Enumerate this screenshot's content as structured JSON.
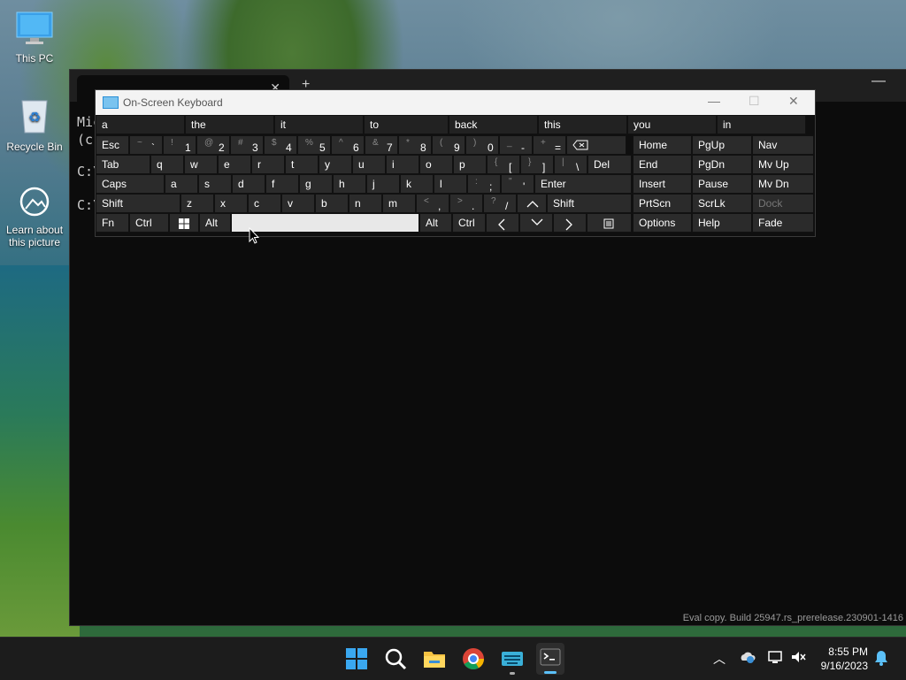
{
  "desktop": {
    "icons": [
      {
        "label": "This PC",
        "icon": "monitor-icon"
      },
      {
        "label": "Recycle Bin",
        "icon": "recycle-bin-icon"
      },
      {
        "label": "Learn about this picture",
        "icon": "learn-icon"
      }
    ]
  },
  "terminal": {
    "lines": [
      "Mic",
      "(c)",
      "C:\\",
      "C:\\"
    ],
    "watermark": "Eval copy. Build 25947.rs_prerelease.230901-1416"
  },
  "osk": {
    "title": "On-Screen Keyboard",
    "predictions": [
      "a",
      "the",
      "it",
      "to",
      "back",
      "this",
      "you",
      "in"
    ],
    "row1": [
      {
        "label": "Esc"
      },
      {
        "sub": "~",
        "main": "`"
      },
      {
        "sub": "!",
        "main": "1"
      },
      {
        "sub": "@",
        "main": "2"
      },
      {
        "sub": "#",
        "main": "3"
      },
      {
        "sub": "$",
        "main": "4"
      },
      {
        "sub": "%",
        "main": "5"
      },
      {
        "sub": "^",
        "main": "6"
      },
      {
        "sub": "&",
        "main": "7"
      },
      {
        "sub": "*",
        "main": "8"
      },
      {
        "sub": "(",
        "main": "9"
      },
      {
        "sub": ")",
        "main": "0"
      },
      {
        "sub": "_",
        "main": "-"
      },
      {
        "sub": "+",
        "main": "="
      }
    ],
    "row2": [
      "Tab",
      "q",
      "w",
      "e",
      "r",
      "t",
      "y",
      "u",
      "i",
      "o",
      "p"
    ],
    "row2_brackets": [
      {
        "sub": "{",
        "main": "["
      },
      {
        "sub": "}",
        "main": "]"
      },
      {
        "sub": "|",
        "main": "\\"
      }
    ],
    "del": "Del",
    "row3": [
      "Caps",
      "a",
      "s",
      "d",
      "f",
      "g",
      "h",
      "j",
      "k",
      "l"
    ],
    "row3_punct": [
      {
        "sub": ":",
        "main": ";"
      },
      {
        "sub": "\"",
        "main": "'"
      }
    ],
    "enter": "Enter",
    "row4": [
      "Shift",
      "z",
      "x",
      "c",
      "v",
      "b",
      "n",
      "m"
    ],
    "row4_punct": [
      {
        "sub": "<",
        "main": ","
      },
      {
        "sub": ">",
        "main": "."
      },
      {
        "sub": "?",
        "main": "/"
      }
    ],
    "shift_right": "Shift",
    "row5": {
      "fn": "Fn",
      "ctrl": "Ctrl",
      "alt": "Alt",
      "alt_right": "Alt",
      "ctrl_right": "Ctrl"
    },
    "nav": [
      [
        "Home",
        "PgUp",
        "Nav"
      ],
      [
        "End",
        "PgDn",
        "Mv Up"
      ],
      [
        "Insert",
        "Pause",
        "Mv Dn"
      ],
      [
        "PrtScn",
        "ScrLk",
        "Dock"
      ],
      [
        "Options",
        "Help",
        "Fade"
      ]
    ]
  },
  "taskbar": {
    "time": "8:55 PM",
    "date": "9/16/2023"
  }
}
